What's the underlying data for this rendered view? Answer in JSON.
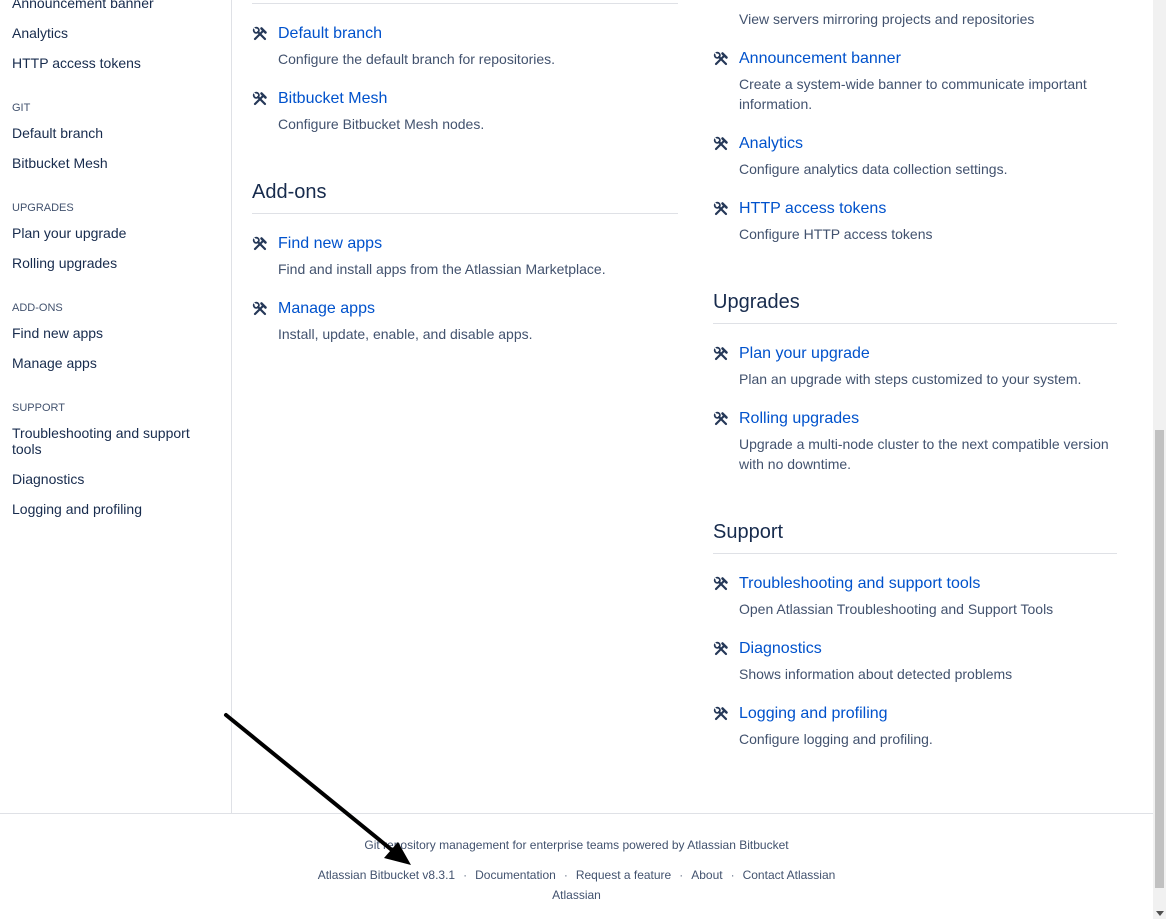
{
  "sidebar": {
    "items": [
      {
        "label": "Announcement banner"
      },
      {
        "label": "Analytics"
      },
      {
        "label": "HTTP access tokens"
      }
    ],
    "groups": [
      {
        "heading": "GIT",
        "items": [
          "Default branch",
          "Bitbucket Mesh"
        ]
      },
      {
        "heading": "UPGRADES",
        "items": [
          "Plan your upgrade",
          "Rolling upgrades"
        ]
      },
      {
        "heading": "ADD-ONS",
        "items": [
          "Find new apps",
          "Manage apps"
        ]
      },
      {
        "heading": "SUPPORT",
        "items": [
          "Troubleshooting and support tools",
          "Diagnostics",
          "Logging and profiling"
        ]
      }
    ]
  },
  "left_column": {
    "git_items": [
      {
        "title": "Default branch",
        "desc": "Configure the default branch for repositories."
      },
      {
        "title": "Bitbucket Mesh",
        "desc": "Configure Bitbucket Mesh nodes."
      }
    ],
    "addons": {
      "title": "Add-ons",
      "items": [
        {
          "title": "Find new apps",
          "desc": "Find and install apps from the Atlassian Marketplace."
        },
        {
          "title": "Manage apps",
          "desc": "Install, update, enable, and disable apps."
        }
      ]
    }
  },
  "right_column": {
    "partial_desc": "View servers mirroring projects and repositories",
    "settings_items": [
      {
        "title": "Announcement banner",
        "desc": "Create a system-wide banner to communicate important information."
      },
      {
        "title": "Analytics",
        "desc": "Configure analytics data collection settings."
      },
      {
        "title": "HTTP access tokens",
        "desc": "Configure HTTP access tokens"
      }
    ],
    "upgrades": {
      "title": "Upgrades",
      "items": [
        {
          "title": "Plan your upgrade",
          "desc": "Plan an upgrade with steps customized to your system."
        },
        {
          "title": "Rolling upgrades",
          "desc": "Upgrade a multi-node cluster to the next compatible version with no downtime."
        }
      ]
    },
    "support": {
      "title": "Support",
      "items": [
        {
          "title": "Troubleshooting and support tools",
          "desc": "Open Atlassian Troubleshooting and Support Tools"
        },
        {
          "title": "Diagnostics",
          "desc": "Shows information about detected problems"
        },
        {
          "title": "Logging and profiling",
          "desc": "Configure logging and profiling."
        }
      ]
    }
  },
  "footer": {
    "tagline": "Git repository management for enterprise teams powered by Atlassian Bitbucket",
    "links": [
      "Atlassian Bitbucket v8.3.1",
      "Documentation",
      "Request a feature",
      "About",
      "Contact Atlassian"
    ],
    "separator": "·",
    "brand": "Atlassian"
  },
  "icons": {
    "item_icon": "tools-icon"
  },
  "colors": {
    "link": "#0052cc",
    "text": "#172b4d",
    "subtle": "#42526e",
    "border": "#dfe1e6"
  }
}
